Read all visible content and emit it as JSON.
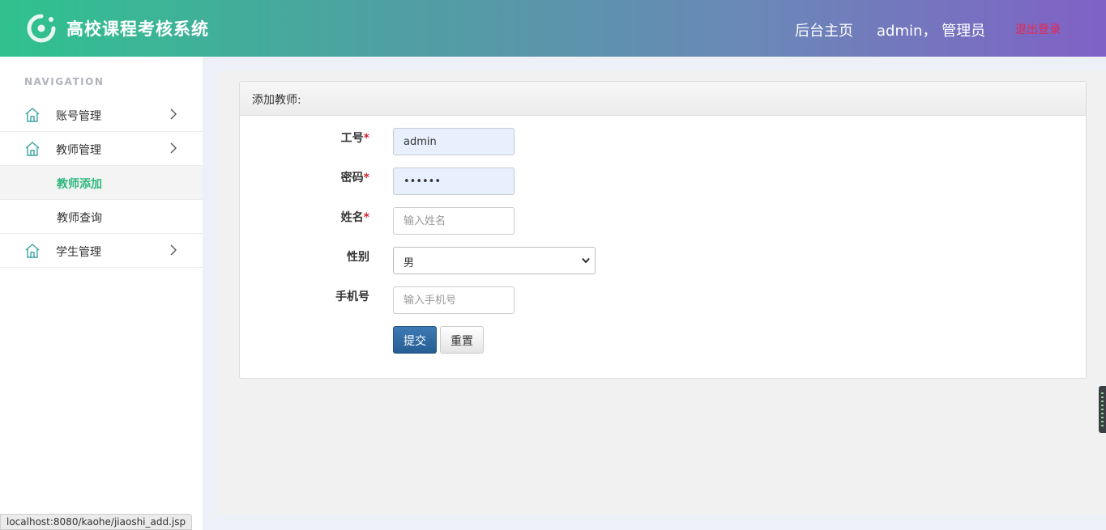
{
  "header": {
    "title": "高校课程考核系统",
    "home_link": "后台主页",
    "user": "admin， 管理员",
    "logout": "退出登录"
  },
  "sidebar": {
    "nav_title": "NAVIGATION",
    "items": [
      {
        "label": "账号管理",
        "icon": "home-icon"
      },
      {
        "label": "教师管理",
        "icon": "home-icon"
      },
      {
        "label": "学生管理",
        "icon": "home-icon"
      }
    ],
    "sub_items": [
      {
        "label": "教师添加",
        "active": true
      },
      {
        "label": "教师查询",
        "active": false
      }
    ]
  },
  "form": {
    "panel_title": "添加教师:",
    "fields": {
      "gonghao": {
        "label": "工号",
        "required": "*",
        "value": "admin"
      },
      "password": {
        "label": "密码",
        "required": "*",
        "value": "111111"
      },
      "name": {
        "label": "姓名",
        "required": "*",
        "placeholder": "输入姓名"
      },
      "gender": {
        "label": "性别",
        "selected": "男"
      },
      "phone": {
        "label": "手机号",
        "placeholder": "输入手机号"
      }
    },
    "submit_label": "提交",
    "reset_label": "重置"
  },
  "statusbar": {
    "url": "localhost:8080/kaohe/jiaoshi_add.jsp"
  },
  "colors": {
    "header_start": "#2fc28e",
    "header_end": "#8061c6",
    "accent_green": "#2fb87f",
    "logout_red": "#e8264f",
    "primary_button": "#275f94"
  }
}
